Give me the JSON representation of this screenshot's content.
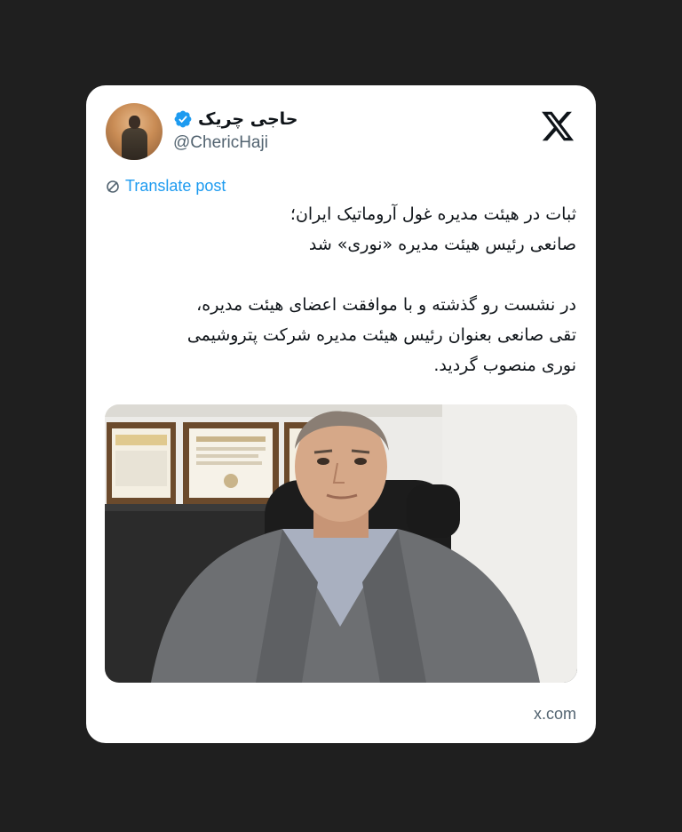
{
  "tweet": {
    "display_name": "حاجی چریک",
    "handle": "@ChericHaji",
    "verified": true,
    "translate_label": "Translate post",
    "text_lines": [
      "ثبات در هیئت مدیره غول آروماتیک ایران؛",
      "صانعی رئیس هیئت مدیره «نوری» شد",
      "در نشست رو گذشته و با موافقت اعضای هیئت مدیره،",
      "تقی صانعی بعنوان رئیس هیئت مدیره شرکت پتروشیمی",
      "نوری منصوب گردید."
    ],
    "source_domain": "x.com"
  },
  "icons": {
    "logo": "x-logo-icon",
    "verified": "verified-badge-icon",
    "translate": "translate-icon"
  },
  "colors": {
    "background": "#1f1f1f",
    "card": "#ffffff",
    "text": "#0f1419",
    "secondary_text": "#536471",
    "link": "#1d9bf0",
    "verified_badge": "#1d9bf0"
  }
}
